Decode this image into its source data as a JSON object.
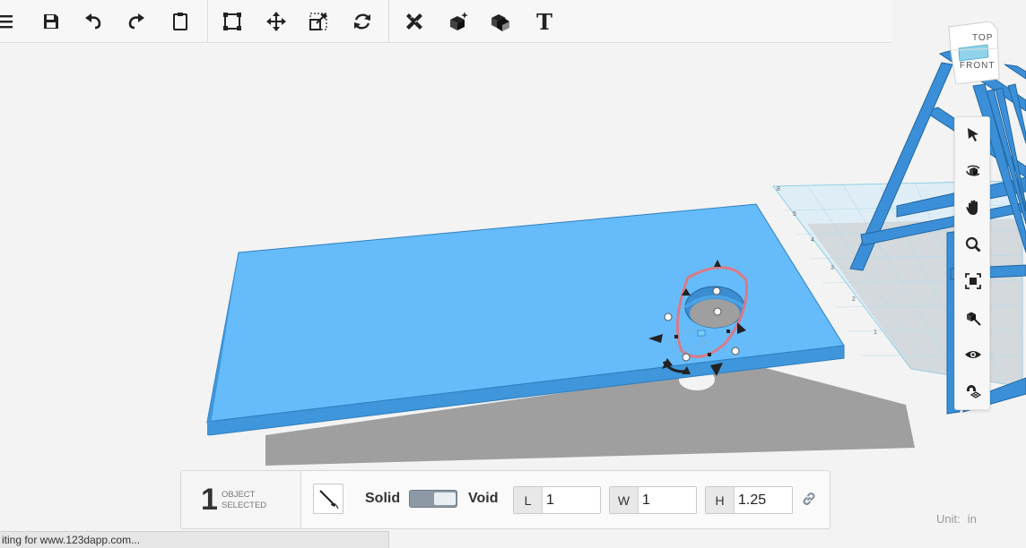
{
  "toolbar": {
    "tools": [
      {
        "id": "menu",
        "icon": "hamburger-icon"
      },
      {
        "id": "save",
        "icon": "save-icon"
      },
      {
        "id": "undo",
        "icon": "undo-icon"
      },
      {
        "id": "redo",
        "icon": "redo-icon"
      },
      {
        "id": "paste",
        "icon": "clipboard-icon"
      },
      {
        "id": "select",
        "icon": "bounding-box-icon"
      },
      {
        "id": "move",
        "icon": "move-icon"
      },
      {
        "id": "scale",
        "icon": "scale-icon"
      },
      {
        "id": "rotate",
        "icon": "rotate-icon"
      },
      {
        "id": "measure",
        "icon": "measure-icon"
      },
      {
        "id": "primitives",
        "icon": "sparkle-box-icon"
      },
      {
        "id": "combine",
        "icon": "cubes-icon"
      },
      {
        "id": "text",
        "icon": "text-icon",
        "label": "T"
      }
    ]
  },
  "viewcube": {
    "top": "TOP",
    "front": "FRONT"
  },
  "navbar": {
    "items": [
      {
        "id": "select",
        "icon": "cursor-icon"
      },
      {
        "id": "orbit",
        "icon": "orbit-icon"
      },
      {
        "id": "pan",
        "icon": "hand-icon"
      },
      {
        "id": "zoom",
        "icon": "magnifier-icon"
      },
      {
        "id": "fit",
        "icon": "fit-view-icon"
      },
      {
        "id": "zoom-selected",
        "icon": "zoom-selected-icon"
      },
      {
        "id": "visibility",
        "icon": "eye-icon"
      },
      {
        "id": "snap",
        "icon": "magnet-grid-icon"
      }
    ]
  },
  "grid": {
    "labels": [
      "8",
      "5",
      "4",
      "3",
      "2",
      "1"
    ]
  },
  "inspector": {
    "count": "1",
    "count_label_1": "OBJECT",
    "count_label_2": "SELECTED",
    "solid_label": "Solid",
    "void_label": "Void",
    "dimensions": [
      {
        "key": "L",
        "value": "1"
      },
      {
        "key": "W",
        "value": "1"
      },
      {
        "key": "H",
        "value": "1.25"
      }
    ]
  },
  "units": {
    "label": "Unit:",
    "value": "in"
  },
  "status": "iting for www.123dapp.com...",
  "colors": {
    "slab_top": "#66bcfa",
    "slab_front": "#3f96da",
    "selection_outline": "#d97a86",
    "chair": "#3a8fd8"
  }
}
